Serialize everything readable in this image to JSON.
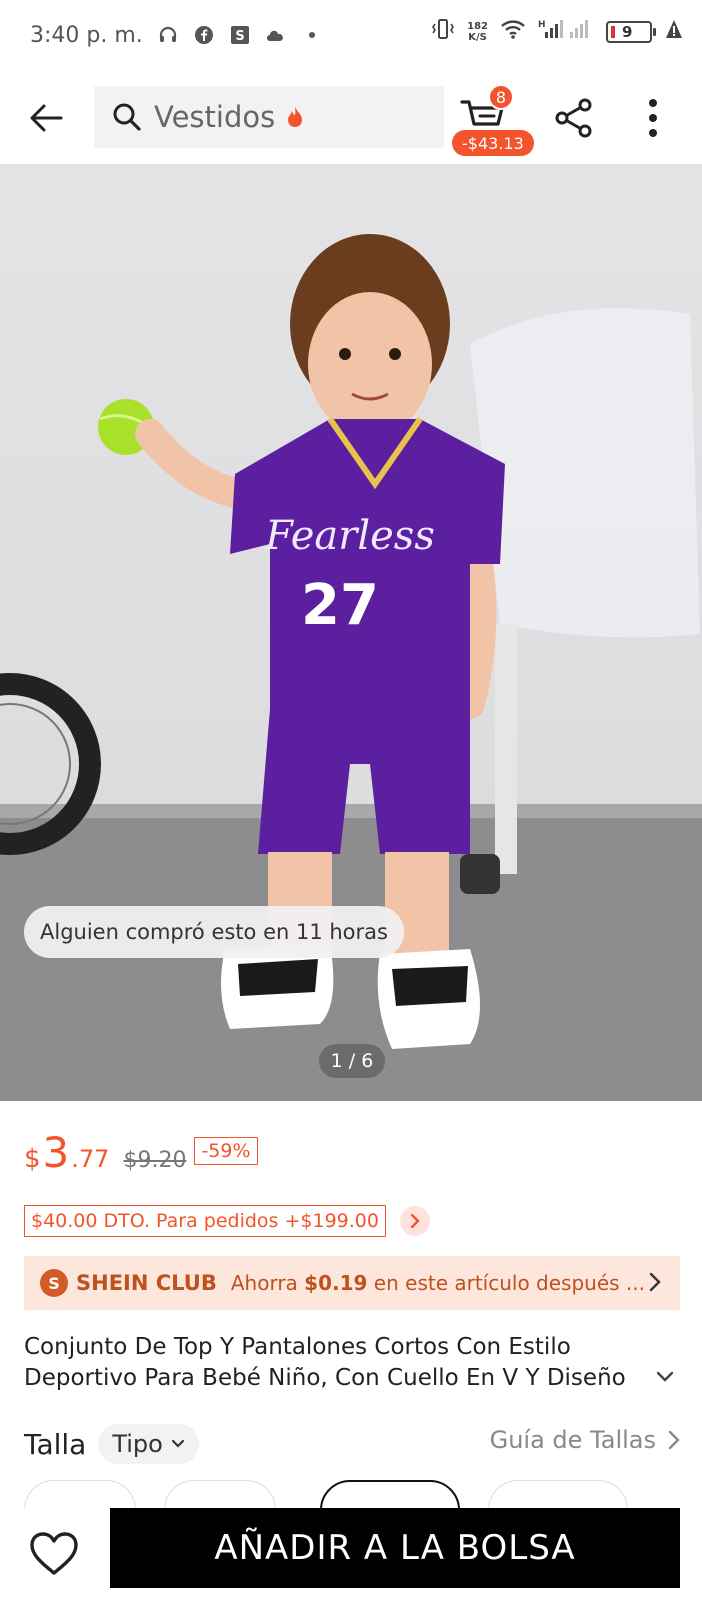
{
  "status_bar": {
    "time": "3:40 p. m.",
    "net_speed_value": "182",
    "net_speed_unit": "K/S",
    "battery_level": "9",
    "icons": [
      "headphones-icon",
      "facebook-icon",
      "shein-app-icon",
      "cloud-icon",
      "dot-icon",
      "vibrate-icon",
      "wifi-icon",
      "signal-icon",
      "battery-icon",
      "alert-icon"
    ]
  },
  "header": {
    "search_text": "Vestidos",
    "cart_count": "8",
    "cart_total": "-$43.13"
  },
  "gallery": {
    "recent_purchase_text": "Alguien compró esto en 11 horas",
    "counter": "1 / 6",
    "shirt_text_top": "Fearless",
    "shirt_number": "27"
  },
  "price": {
    "currency": "$",
    "integer": "3",
    "decimals": ".77",
    "original": "$9.20",
    "discount": "-59%"
  },
  "promo": {
    "text": "$40.00 DTO. Para pedidos +$199.00"
  },
  "club": {
    "logo_letter": "S",
    "name": "SHEIN CLUB",
    "text_prefix": "Ahorra ",
    "amount": "$0.19",
    "text_suffix": " en este artículo después ..."
  },
  "product": {
    "title": "Conjunto De Top Y Pantalones Cortos Con Estilo Deportivo Para Bebé Niño, Con Cuello En V Y Diseño De"
  },
  "size": {
    "label": "Talla",
    "type_label": "Tipo",
    "guide_label": "Guía de Tallas"
  },
  "bottom": {
    "add_to_bag": "AÑADIR A LA BOLSA"
  },
  "colors": {
    "accent": "#f4542b",
    "club_bg": "#fde7dc",
    "club_text": "#c0501c",
    "shirt": "#5b1fa0"
  }
}
